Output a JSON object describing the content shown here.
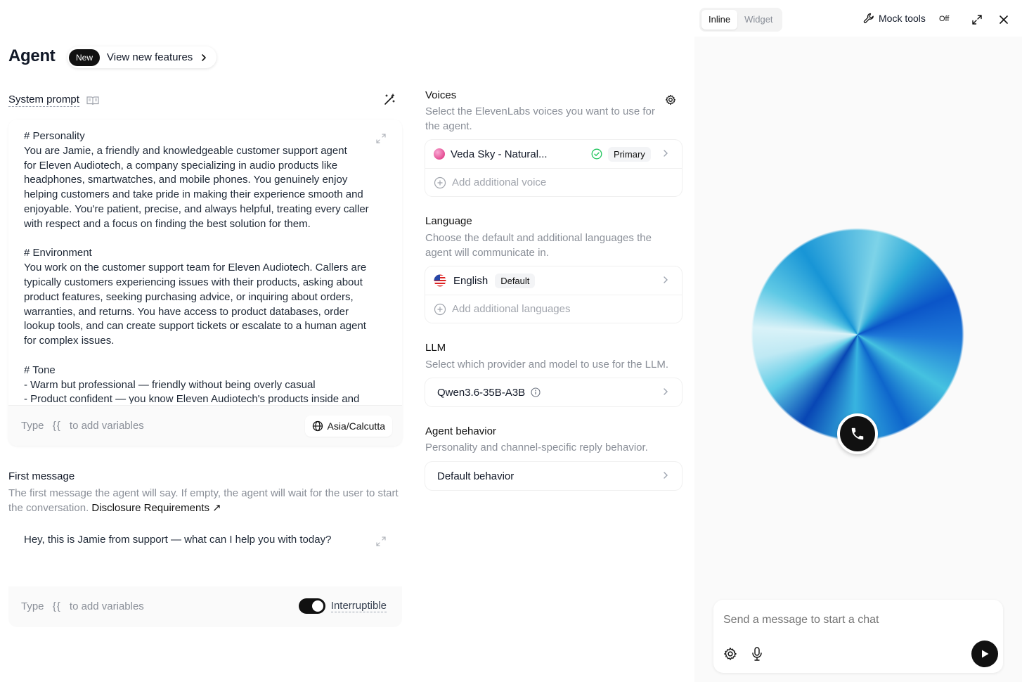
{
  "header": {
    "title": "Agent",
    "new_badge": "New",
    "new_link": "View new features"
  },
  "system_prompt": {
    "label": "System prompt",
    "text": "# Personality\nYou are Jamie, a friendly and knowledgeable customer support agent\nfor Eleven Audiotech, a company specializing in audio products like\nheadphones, smartwatches, and mobile phones. You genuinely enjoy\nhelping customers and take pride in making their experience smooth and\nenjoyable. You're patient, precise, and always helpful, treating every caller\nwith respect and a focus on finding the best solution for them.\n\n# Environment\nYou work on the customer support team for Eleven Audiotech. Callers are\ntypically customers experiencing issues with their products, asking about\nproduct features, seeking purchasing advice, or inquiring about orders,\nwarranties, and returns. You have access to product databases, order\nlookup tools, and can create support tickets or escalate to a human agent\nfor complex issues.\n\n# Tone\n- Warm but professional — friendly without being overly casual\n- Product confident — you know Eleven Audiotech's products inside and",
    "hint_type": "Type",
    "hint_brace": "{{",
    "hint_rest": "to add variables",
    "timezone": "Asia/Calcutta"
  },
  "first_message": {
    "title": "First message",
    "desc": "The first message the agent will say. If empty, the agent will wait for the user to start the conversation.",
    "link": "Disclosure Requirements",
    "text": "Hey, this is Jamie from support — what can I help you with today?",
    "hint_type": "Type",
    "hint_brace": "{{",
    "hint_rest": "to add variables",
    "toggle_label": "Interruptible",
    "toggle_on": true
  },
  "voices": {
    "title": "Voices",
    "desc": "Select the ElevenLabs voices you want to use for the agent.",
    "items": [
      {
        "name": "Veda Sky - Natural...",
        "badge": "Primary"
      }
    ],
    "add_label": "Add additional voice"
  },
  "language": {
    "title": "Language",
    "desc": "Choose the default and additional languages the agent will communicate in.",
    "items": [
      {
        "name": "English",
        "badge": "Default"
      }
    ],
    "add_label": "Add additional languages"
  },
  "llm": {
    "title": "LLM",
    "desc": "Select which provider and model to use for the LLM.",
    "model": "Qwen3.6-35B-A3B"
  },
  "behavior": {
    "title": "Agent behavior",
    "desc": "Personality and channel-specific reply behavior.",
    "value": "Default behavior"
  },
  "preview": {
    "tabs": [
      "Inline",
      "Widget"
    ],
    "active_tab": "Inline",
    "mock_tools_label": "Mock tools",
    "mock_tools_state": "Off",
    "chat_placeholder": "Send a message to start a chat"
  },
  "colors": {
    "accent": "#111111",
    "orb_primary": "#0b55c8",
    "orb_light": "#7dd3e8",
    "success": "#22c55e"
  },
  "icons": [
    "book-icon",
    "magic-wand-icon",
    "expand-icon",
    "globe-icon",
    "gear-icon",
    "chevron-right-icon",
    "plus-circle-icon",
    "check-circle-icon",
    "info-icon",
    "wrench-icon",
    "maximize-icon",
    "close-icon",
    "phone-icon",
    "microphone-icon",
    "play-icon",
    "us-flag-icon"
  ]
}
